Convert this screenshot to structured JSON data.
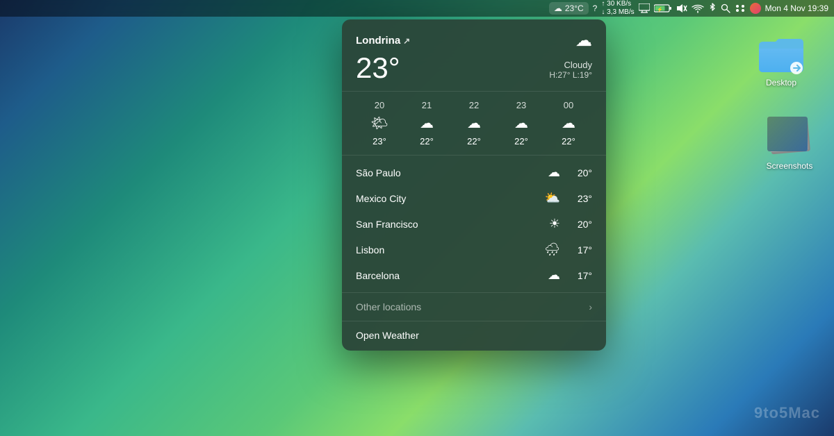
{
  "wallpaper": {
    "alt": "macOS gradient wallpaper"
  },
  "menubar": {
    "weather_icon": "☁",
    "weather_temp": "23°C",
    "question_mark": "?",
    "network_up": "30 KB/s",
    "network_down": "3,3 MB/s",
    "display_icon": "🖥",
    "battery_icon": "⚡",
    "mute_icon": "🔇",
    "wifi_icon": "WiFi",
    "bluetooth_icon": "Bluetooth",
    "search_icon": "Search",
    "control_icon": "Control",
    "avatar_icon": "Avatar",
    "date_time": "Mon 4 Nov  19:39"
  },
  "desktop": {
    "folder_label": "Desktop",
    "screenshots_label": "Screenshots"
  },
  "weather_popup": {
    "location": "Londrina",
    "location_arrow": "↗",
    "condition": "Cloudy",
    "high_low": "H:27°  L:19°",
    "current_temp": "23°",
    "hourly": [
      {
        "hour": "20",
        "icon": "🌤",
        "temp": "23°"
      },
      {
        "hour": "21",
        "icon": "☁",
        "temp": "22°"
      },
      {
        "hour": "22",
        "icon": "☁",
        "temp": "22°"
      },
      {
        "hour": "23",
        "icon": "☁",
        "temp": "22°"
      },
      {
        "hour": "00",
        "icon": "☁",
        "temp": "22°"
      }
    ],
    "cities": [
      {
        "name": "São Paulo",
        "icon": "☁",
        "temp": "20°"
      },
      {
        "name": "Mexico City",
        "icon": "⛅",
        "temp": "23°"
      },
      {
        "name": "San Francisco",
        "icon": "☀",
        "temp": "20°"
      },
      {
        "name": "Lisbon",
        "icon": "🌧",
        "temp": "17°"
      },
      {
        "name": "Barcelona",
        "icon": "☁",
        "temp": "17°"
      }
    ],
    "other_locations_label": "Other locations",
    "open_weather_label": "Open Weather"
  },
  "watermark": "9to5Mac"
}
